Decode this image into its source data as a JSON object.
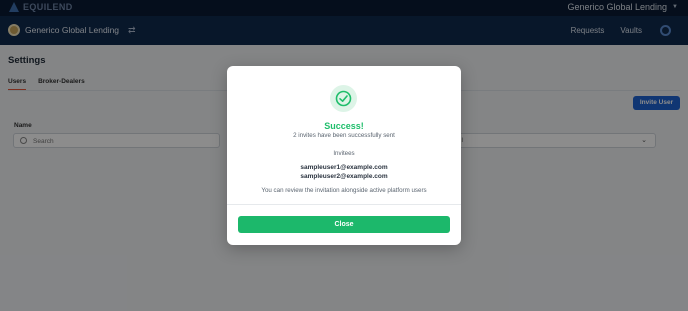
{
  "topbar": {
    "brand": "EQUILEND",
    "org_switcher": "Generico Global Lending"
  },
  "appbar": {
    "app_name": "Generico Global Lending",
    "nav": [
      "Requests",
      "Vaults"
    ]
  },
  "page": {
    "title": "Settings",
    "tabs": [
      "Users",
      "Broker-Dealers"
    ],
    "active_tab": "Users",
    "invite_button": "Invite User",
    "filters": {
      "name_label": "Name",
      "search_placeholder": "Search",
      "status_label": "tus",
      "status_value": "ll"
    }
  },
  "modal": {
    "title": "Success!",
    "subtitle": "2 invites have been successfully sent",
    "invitees_label": "Invitees",
    "invitees": [
      "sampleuser1@example.com",
      "sampleuser2@example.com"
    ],
    "note": "You can review the invitation alongside active platform users",
    "close_label": "Close"
  },
  "colors": {
    "success": "#1fbe6b",
    "primary": "#1e63d2",
    "accent_tab": "#e3573a",
    "header": "#0a1a33"
  }
}
